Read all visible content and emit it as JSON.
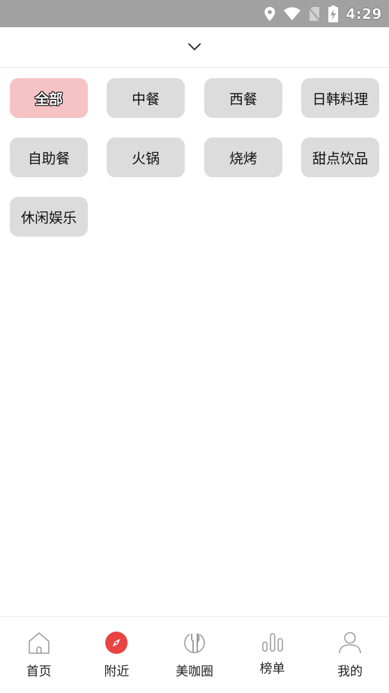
{
  "status_bar": {
    "time": "4:29",
    "icons": [
      "location-icon",
      "wifi-icon",
      "no-sim-icon",
      "battery-charging-icon"
    ]
  },
  "dropdown": {
    "icon": "chevron-down-icon"
  },
  "categories": [
    {
      "label": "全部",
      "active": true
    },
    {
      "label": "中餐"
    },
    {
      "label": "西餐"
    },
    {
      "label": "日韩料理"
    },
    {
      "label": "自助餐"
    },
    {
      "label": "火锅"
    },
    {
      "label": "烧烤"
    },
    {
      "label": "甜点饮品"
    },
    {
      "label": "休闲娱乐"
    }
  ],
  "colors": {
    "status_bar_bg": "#a1a1a1",
    "active_chip": "#f6c3c4",
    "chip": "#dcdcdc",
    "accent": "#e94444"
  },
  "tabbar": {
    "items": [
      {
        "label": "首页",
        "icon": "home-icon"
      },
      {
        "label": "附近",
        "icon": "compass-icon",
        "active": true
      },
      {
        "label": "美咖圈",
        "icon": "dining-icon"
      },
      {
        "label": "榜单",
        "icon": "bar-chart-icon"
      },
      {
        "label": "我的",
        "icon": "user-icon"
      }
    ]
  }
}
